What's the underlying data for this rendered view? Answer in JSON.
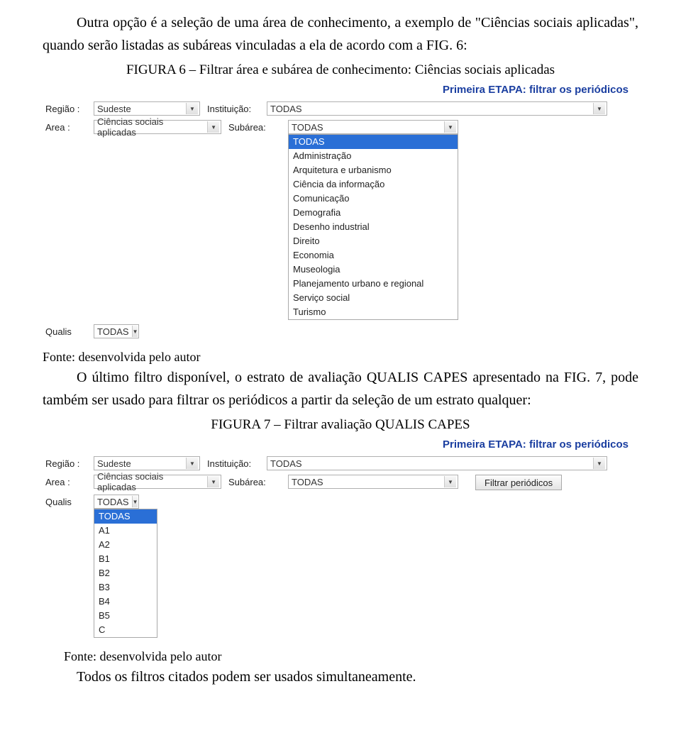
{
  "text": {
    "p1": "Outra opção é a seleção de uma área de conhecimento, a exemplo de \"Ciências sociais aplicadas\", quando serão listadas as subáreas vinculadas a ela de acordo com a FIG. 6:",
    "caption6": "FIGURA 6 – Filtrar área e subárea de conhecimento: Ciências sociais aplicadas",
    "etapa_title": "Primeira ETAPA: filtrar os periódicos",
    "fonte": "Fonte: desenvolvida pelo autor",
    "p2": "O último filtro disponível, o estrato de avaliação QUALIS CAPES apresentado na FIG. 7, pode também ser usado para filtrar os periódicos a partir da seleção de um estrato qualquer:",
    "caption7": "FIGURA 7 – Filtrar avaliação QUALIS CAPES",
    "p3": "Todos os filtros citados podem ser usados simultaneamente."
  },
  "labels": {
    "regiao": "Região :",
    "instituicao": "Instituição:",
    "area": "Area :",
    "subarea": "Subárea:",
    "qualis": "Qualis",
    "filtrar_btn": "Filtrar periódicos"
  },
  "fig6": {
    "regiao": "Sudeste",
    "instituicao": "TODAS",
    "area": "Ciências sociais aplicadas",
    "subarea_selected": "TODAS",
    "qualis": "TODAS",
    "subarea_options": [
      "TODAS",
      "Administração",
      "Arquitetura e urbanismo",
      "Ciência da informação",
      "Comunicação",
      "Demografia",
      "Desenho industrial",
      "Direito",
      "Economia",
      "Museologia",
      "Planejamento urbano e regional",
      "Serviço social",
      "Turismo"
    ]
  },
  "fig7": {
    "regiao": "Sudeste",
    "instituicao": "TODAS",
    "area": "Ciências sociais aplicadas",
    "subarea": "TODAS",
    "qualis_selected": "TODAS",
    "qualis_options": [
      "TODAS",
      "A1",
      "A2",
      "B1",
      "B2",
      "B3",
      "B4",
      "B5",
      "C"
    ]
  }
}
